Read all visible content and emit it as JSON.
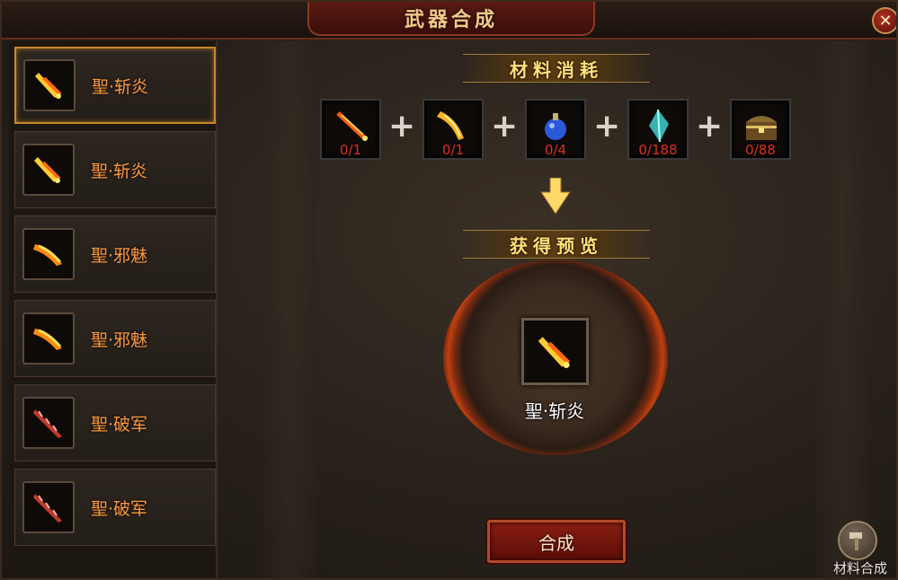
{
  "window": {
    "title": "武器合成"
  },
  "sidebar": {
    "items": [
      {
        "label": "聖·斩炎",
        "icon": "flame-sword-icon",
        "selected": true
      },
      {
        "label": "聖·斩炎",
        "icon": "flame-sword-icon",
        "selected": false
      },
      {
        "label": "聖·邪魅",
        "icon": "fire-blade-icon",
        "selected": false
      },
      {
        "label": "聖·邪魅",
        "icon": "fire-blade-icon",
        "selected": false
      },
      {
        "label": "聖·破军",
        "icon": "red-blade-icon",
        "selected": false
      },
      {
        "label": "聖·破军",
        "icon": "red-blade-icon",
        "selected": false
      }
    ]
  },
  "materials": {
    "title": "材料消耗",
    "items": [
      {
        "icon": "fire-sword-icon",
        "count": "0/1"
      },
      {
        "icon": "gold-blade-icon",
        "count": "0/1"
      },
      {
        "icon": "blue-potion-icon",
        "count": "0/4"
      },
      {
        "icon": "crystal-icon",
        "count": "0/188"
      },
      {
        "icon": "treasure-chest-icon",
        "count": "0/88"
      }
    ]
  },
  "preview": {
    "title": "获得预览",
    "name": "聖·斩炎",
    "icon": "flame-sword-icon"
  },
  "actions": {
    "craft_label": "合成",
    "material_craft_label": "材料合成"
  },
  "colors": {
    "accent": "#ff9a3c",
    "count_red": "#e03020",
    "title_gold": "#ffe07a"
  }
}
